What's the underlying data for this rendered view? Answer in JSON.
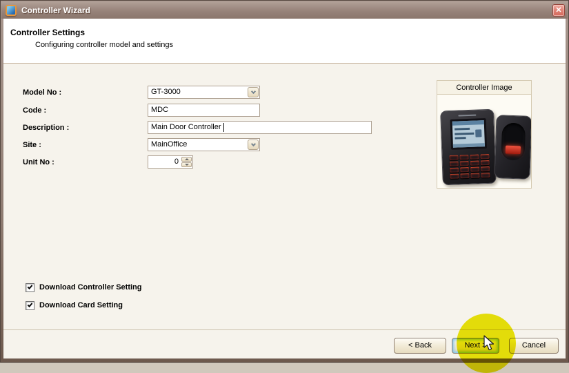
{
  "window": {
    "title": "Controller Wizard",
    "close_glyph": "✕"
  },
  "header": {
    "title": "Controller Settings",
    "subtitle": "Configuring controller model and settings"
  },
  "form": {
    "fields": [
      {
        "label": "Model No :",
        "value": "GT-3000",
        "type": "dropdown"
      },
      {
        "label": "Code :",
        "value": "MDC",
        "type": "text"
      },
      {
        "label": "Description :",
        "value": "Main Door Controller",
        "type": "text"
      },
      {
        "label": "Site :",
        "value": "MainOffice",
        "type": "dropdown"
      },
      {
        "label": "Unit No :",
        "value": "0",
        "type": "spinner"
      }
    ]
  },
  "panel": {
    "title": "Controller Image"
  },
  "checkboxes": [
    {
      "label": "Download Controller Setting",
      "checked": true
    },
    {
      "label": "Download Card Setting",
      "checked": true
    }
  ],
  "buttons": {
    "back": "< Back",
    "next": "Next >",
    "cancel": "Cancel"
  },
  "colors": {
    "titlebar": "#97837a",
    "close_button": "#d4685a",
    "content_bg": "#f6f3ec",
    "header_bg": "#ffffff",
    "highlight_circle": "#ece600",
    "input_border": "#ada091"
  }
}
